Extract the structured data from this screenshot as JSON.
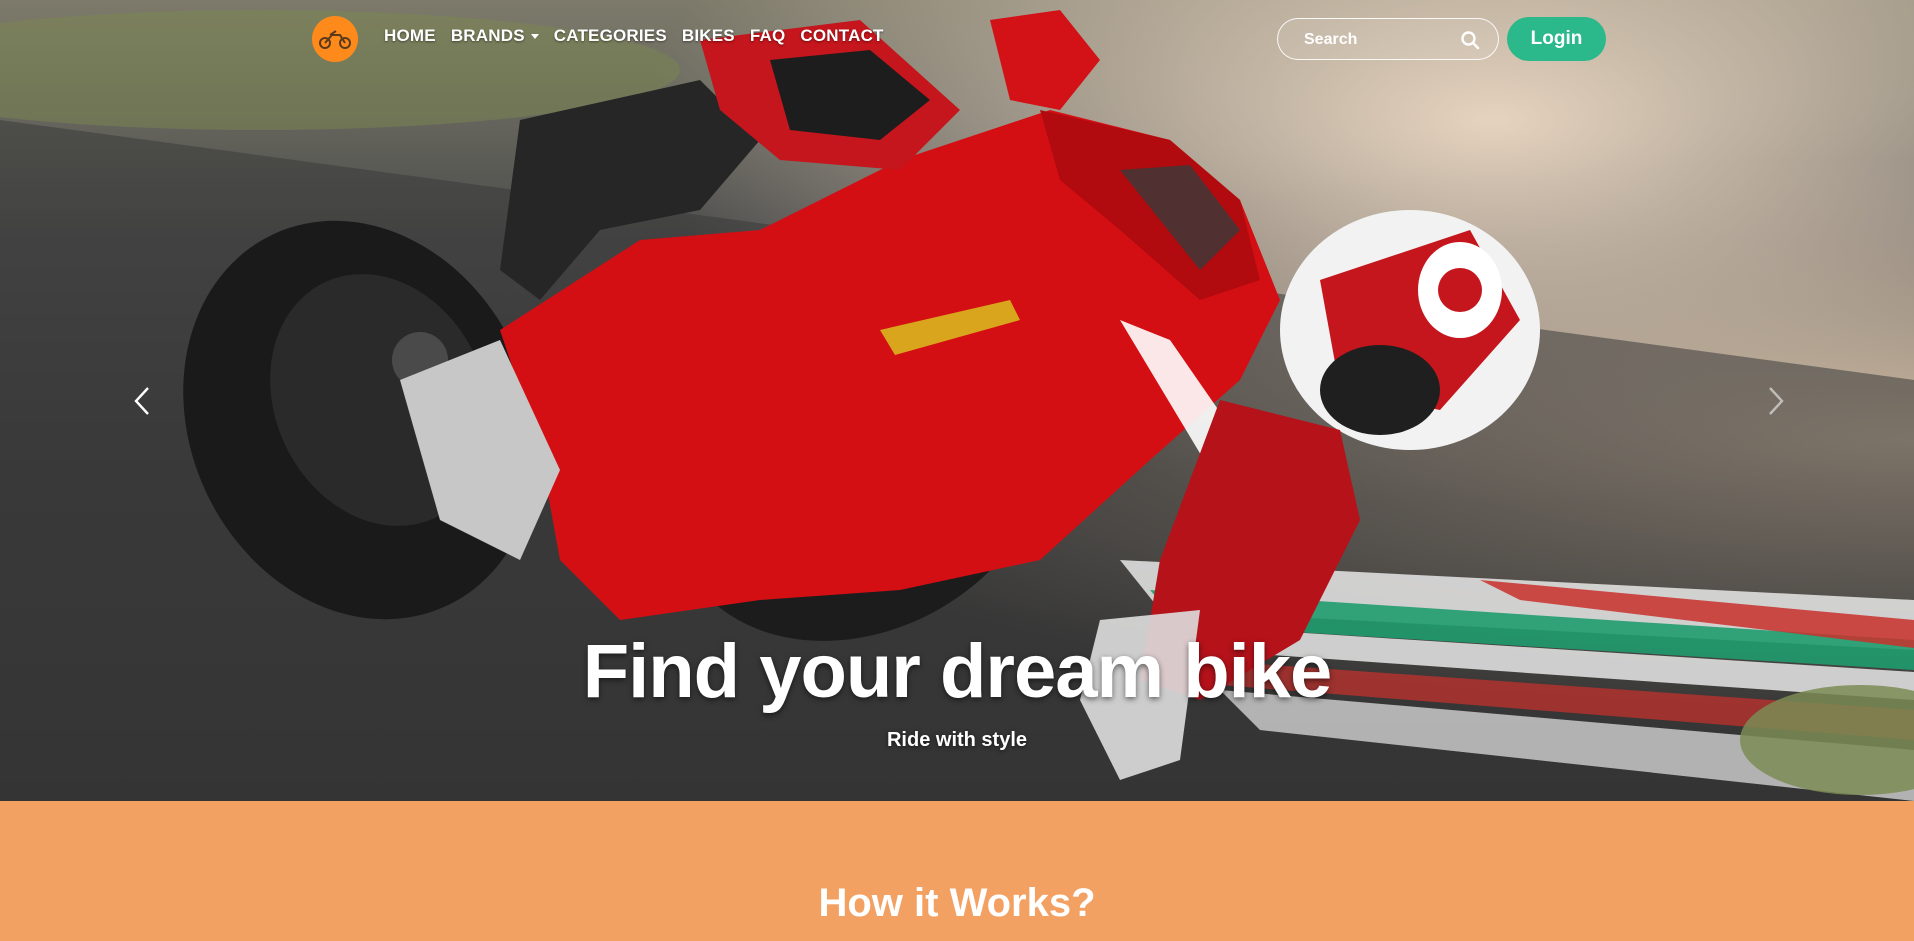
{
  "nav": {
    "logo_icon": "motorcycle-icon",
    "links": [
      {
        "label": "HOME"
      },
      {
        "label": "BRANDS",
        "has_dropdown": true
      },
      {
        "label": "CATEGORIES"
      },
      {
        "label": "BIKES"
      },
      {
        "label": "FAQ"
      },
      {
        "label": "CONTACT"
      }
    ],
    "search": {
      "placeholder": "Search",
      "icon": "search-icon"
    },
    "login_label": "Login"
  },
  "hero": {
    "title": "Find your dream bike",
    "subtitle": "Ride with style",
    "prev_icon": "chevron-left-icon",
    "next_icon": "chevron-right-icon"
  },
  "how_it_works": {
    "title": "How it Works?"
  },
  "colors": {
    "logo_bg": "#ff8a1c",
    "login_bg": "#2bb88a",
    "section_bg": "#f3a163",
    "bike_red": "#d40f14"
  }
}
